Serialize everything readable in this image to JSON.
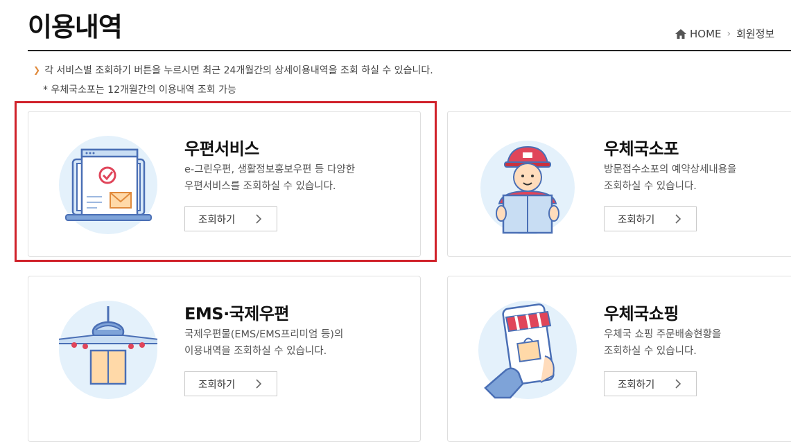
{
  "page": {
    "title": "이용내역"
  },
  "breadcrumb": {
    "home": "HOME",
    "level1": "회원정보"
  },
  "notice": {
    "main": "각 서비스별 조회하기 버튼을 누르시면 최근 24개월간의 상세이용내역을 조회 하실 수 있습니다.",
    "sub": "* 우체국소포는 12개월간의 이용내역 조회 가능"
  },
  "cards": [
    {
      "title": "우편서비스",
      "desc1": "e-그린우편, 생활정보홍보우편 등 다양한",
      "desc2": "우편서비스를 조회하실 수 있습니다.",
      "button": "조회하기",
      "icon": "laptop-mail-icon"
    },
    {
      "title": "우체국소포",
      "desc1": "방문접수소포의 예약상세내용을",
      "desc2": "조회하실 수 있습니다.",
      "button": "조회하기",
      "icon": "courier-parcel-icon"
    },
    {
      "title": "EMS·국제우편",
      "desc1": "국제우편물(EMS/EMS프리미엄 등)의",
      "desc2": "이용내역을 조회하실 수 있습니다.",
      "button": "조회하기",
      "icon": "airplane-parcel-icon"
    },
    {
      "title": "우체국쇼핑",
      "desc1": "우체국 쇼핑 주문배송현황을",
      "desc2": "조회하실 수 있습니다.",
      "button": "조회하기",
      "icon": "mobile-shop-icon"
    }
  ],
  "colors": {
    "accent_orange": "#e08a3c",
    "highlight_red": "#d0212a",
    "illust_bg": "#e4f1fb",
    "illust_blue": "#5b7fc0"
  }
}
